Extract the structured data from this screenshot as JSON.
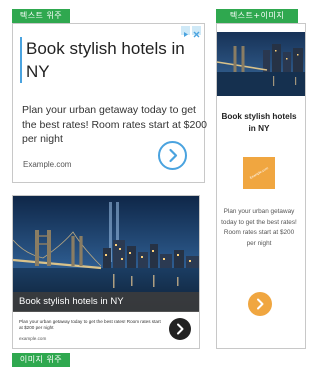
{
  "colors": {
    "tag_green": "#2fa84f",
    "chevron_blue": "#4aa3df",
    "orange": "#f0a640",
    "dark_button": "#222222"
  },
  "labels": {
    "text_priority": "텍스트 위주",
    "image_priority": "이미지 위주",
    "text_plus_image": "텍스트+이미지"
  },
  "ad_text": {
    "title": "Book stylish hotels in NY",
    "body": "Plan your urban getaway today to get the best rates! Room rates start at $200 per night",
    "domain": "Example.com",
    "adchoices_icons": [
      "play-triangle-icon",
      "close-x-icon"
    ],
    "cta_icon": "chevron-right-icon"
  },
  "ad_image": {
    "caption": "Book stylish hotels in NY",
    "body": "Plan your urban getaway today to get the best rates! Room rates start at $200 per night",
    "domain": "example.com",
    "cta_icon": "chevron-right-icon"
  },
  "ad_mixed": {
    "title": "Book stylish hotels in NY",
    "body": "Plan your urban getaway today to get the best rates! Room rates start at $200 per night",
    "logo_text": "Example.com",
    "cta_icon": "chevron-right-icon"
  }
}
